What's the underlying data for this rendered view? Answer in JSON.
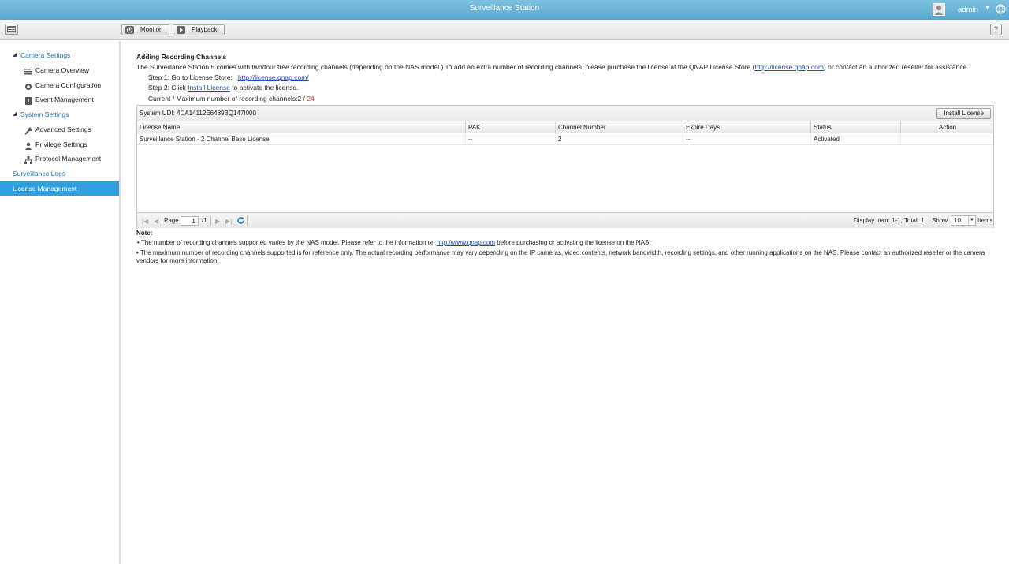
{
  "titlebar": {
    "title": "Surveillance Station",
    "user": "admin"
  },
  "toolbar": {
    "monitor_label": "Monitor",
    "playback_label": "Playback",
    "help_label": "?"
  },
  "sidebar": {
    "camera_settings": "Camera Settings",
    "camera_overview": "Camera Overview",
    "camera_configuration": "Camera Configuration",
    "event_management": "Event Management",
    "system_settings": "System Settings",
    "advanced_settings": "Advanced Settings",
    "privilege_settings": "Privilege Settings",
    "protocol_management": "Protocol Management",
    "surveillance_logs": "Surveillance Logs",
    "license_management": "License Management"
  },
  "main": {
    "heading": "Adding Recording Channels",
    "intro_part1": "The Surveillance Station 5 comes with two/four free recording channels (depending on the NAS model.) To add an extra number of recording channels, please purchase the license at the QNAP License Store (",
    "intro_link": "http://license.qnap.com",
    "intro_part2": ") or contact an authorized reseller for assistance.",
    "step1_text": "Step 1: Go to License Store:",
    "step1_link": "http://license.qnap.com/",
    "step2_pre": "Step 2: Click ",
    "step2_link": "Install License",
    "step2_post": " to activate the license.",
    "channels_label": "Current / Maximum number of recording channels:",
    "channels_current": "2",
    "channels_sep": " / ",
    "channels_max": "24"
  },
  "grid": {
    "system_udi": "System UDI: 4CA14112E6489BQ147I000",
    "install_button": "Install License",
    "columns": [
      "License Name",
      "PAK",
      "Channel Number",
      "Expire Days",
      "Status",
      "Action"
    ],
    "rows": [
      {
        "name": "Surveillance Station - 2 Channel Base License",
        "pak": "--",
        "channels": "2",
        "expire": "--",
        "status": "Activated",
        "action": ""
      }
    ]
  },
  "pager": {
    "page_label": "Page",
    "page_value": "1",
    "page_total": "/1",
    "display": "Display item: 1-1, Total: 1",
    "show_label": "Show",
    "show_value": "10",
    "items_label": "Items"
  },
  "notes": {
    "title": "Note:",
    "note1_pre": "• The number of recording channels supported varies by the NAS model. Please refer to the information on ",
    "note1_link": "http://www.qnap.com",
    "note1_post": " before purchasing or activating the license on the NAS.",
    "note2": "• The maximum number of recording channels supported is for reference only. The actual recording performance may vary depending on the IP cameras, video contents, network bandwidth, recording settings, and other running applications on the NAS. Please contact an authorized reseller or the camera vendors for more information."
  }
}
